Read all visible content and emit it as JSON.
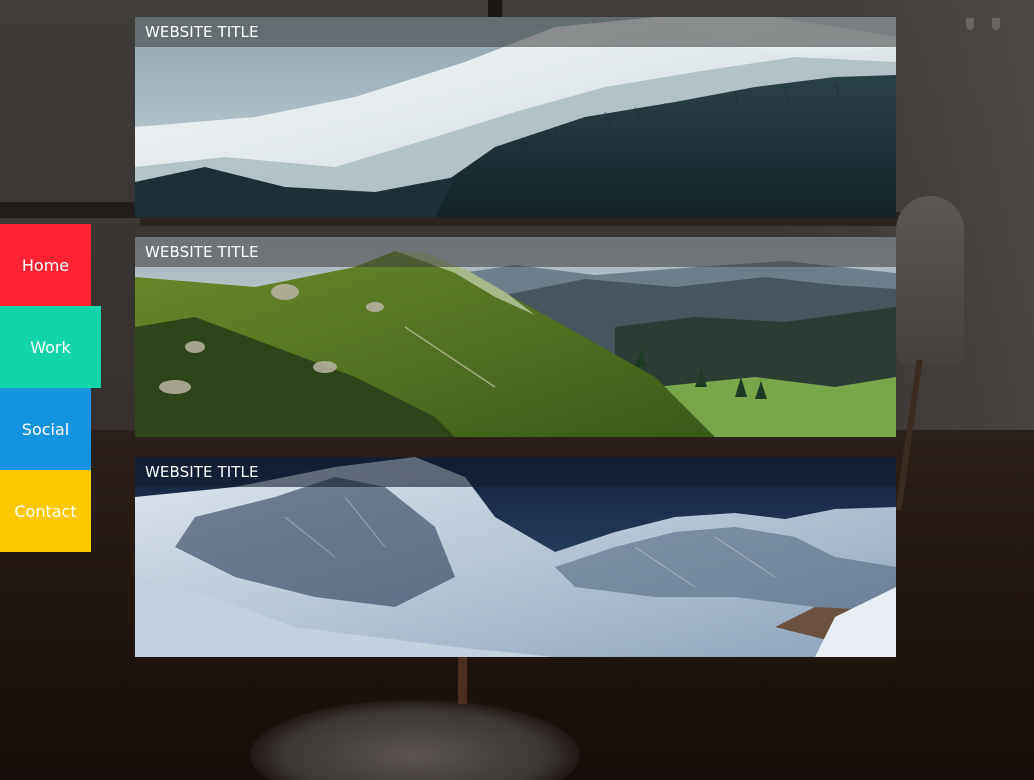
{
  "nav": {
    "items": [
      {
        "label": "Home",
        "color": "#ff2233"
      },
      {
        "label": "Work",
        "color": "#12d6aa",
        "active": true
      },
      {
        "label": "Social",
        "color": "#1592e0"
      },
      {
        "label": "Contact",
        "color": "#ffc800"
      }
    ]
  },
  "cards": [
    {
      "title": "WEBSITE TITLE",
      "image": "snowy-forested-mountain-slope"
    },
    {
      "title": "WEBSITE TITLE",
      "image": "green-alpine-valley"
    },
    {
      "title": "WEBSITE TITLE",
      "image": "snowy-rocky-peaks-at-dusk"
    }
  ]
}
